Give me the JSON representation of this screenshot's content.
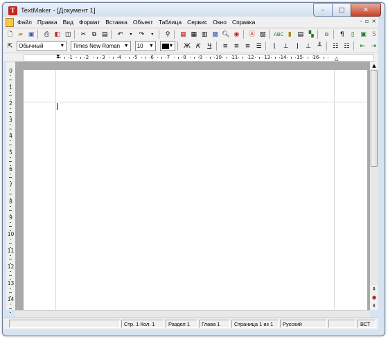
{
  "window": {
    "title": "TextMaker - [Документ 1]",
    "app_icon_letter": "T"
  },
  "caption_buttons": {
    "minimize": "–",
    "maximize": "□",
    "close": "✕"
  },
  "menu": {
    "items": [
      "Файл",
      "Правка",
      "Вид",
      "Формат",
      "Вставка",
      "Объект",
      "Таблица",
      "Сервис",
      "Окно",
      "Справка"
    ],
    "mdi": {
      "minimize": "–",
      "restore": "▫",
      "close": "×"
    }
  },
  "toolbar1": {
    "icons": [
      "new-document-icon",
      "open-folder-icon",
      "save-icon",
      "print-icon",
      "pdf-export-icon",
      "print-preview-icon",
      "cut-icon",
      "copy-icon",
      "paste-icon",
      "undo-icon",
      "redo-icon",
      "find-icon",
      "insert-frame-icon",
      "insert-table-icon",
      "columns-icon",
      "insert-picture-icon",
      "zoom-icon",
      "zoom-page-icon",
      "text-frame-icon",
      "insert-chart-icon",
      "spellcheck-icon",
      "insert-object-icon",
      "styles-icon",
      "paragraph-marks-icon",
      "field-icon",
      "outline-icon",
      "web-icon",
      "presentations-icon",
      "planmaker-icon"
    ]
  },
  "toolbar2": {
    "style_value": "Обычный",
    "font_value": "Times New Roman",
    "size_value": "10",
    "text_color": "#000000",
    "icons": [
      "arrow-select-icon",
      "bold-clear-icon",
      "italic-clear-icon",
      "underline-clear-icon",
      "align-left-icon",
      "align-center-icon",
      "align-right-icon",
      "justify-icon",
      "tab-left-icon",
      "tab-center-icon",
      "tab-right-icon",
      "tab-decimal-icon",
      "tab-bar-icon",
      "bullets-icon",
      "numbering-icon",
      "decrease-indent-icon",
      "increase-indent-icon"
    ]
  },
  "ruler": {
    "labels": [
      "1",
      "2",
      "3",
      "4",
      "5",
      "6",
      "7",
      "8",
      "9",
      "10",
      "11",
      "12",
      "13",
      "14",
      "15",
      "16"
    ],
    "vertical_labels": [
      "0",
      "1",
      "2",
      "3",
      "4",
      "5",
      "6",
      "7",
      "8",
      "9",
      "10",
      "11",
      "12",
      "13",
      "14"
    ],
    "corner_label": "L"
  },
  "status": {
    "position": "Стр. 1 Кол. 1",
    "section": "Раздел 1",
    "chapter": "Глава 1",
    "page": "Страница 1 из 1",
    "language": "Русский",
    "mode": "ВСТ"
  }
}
